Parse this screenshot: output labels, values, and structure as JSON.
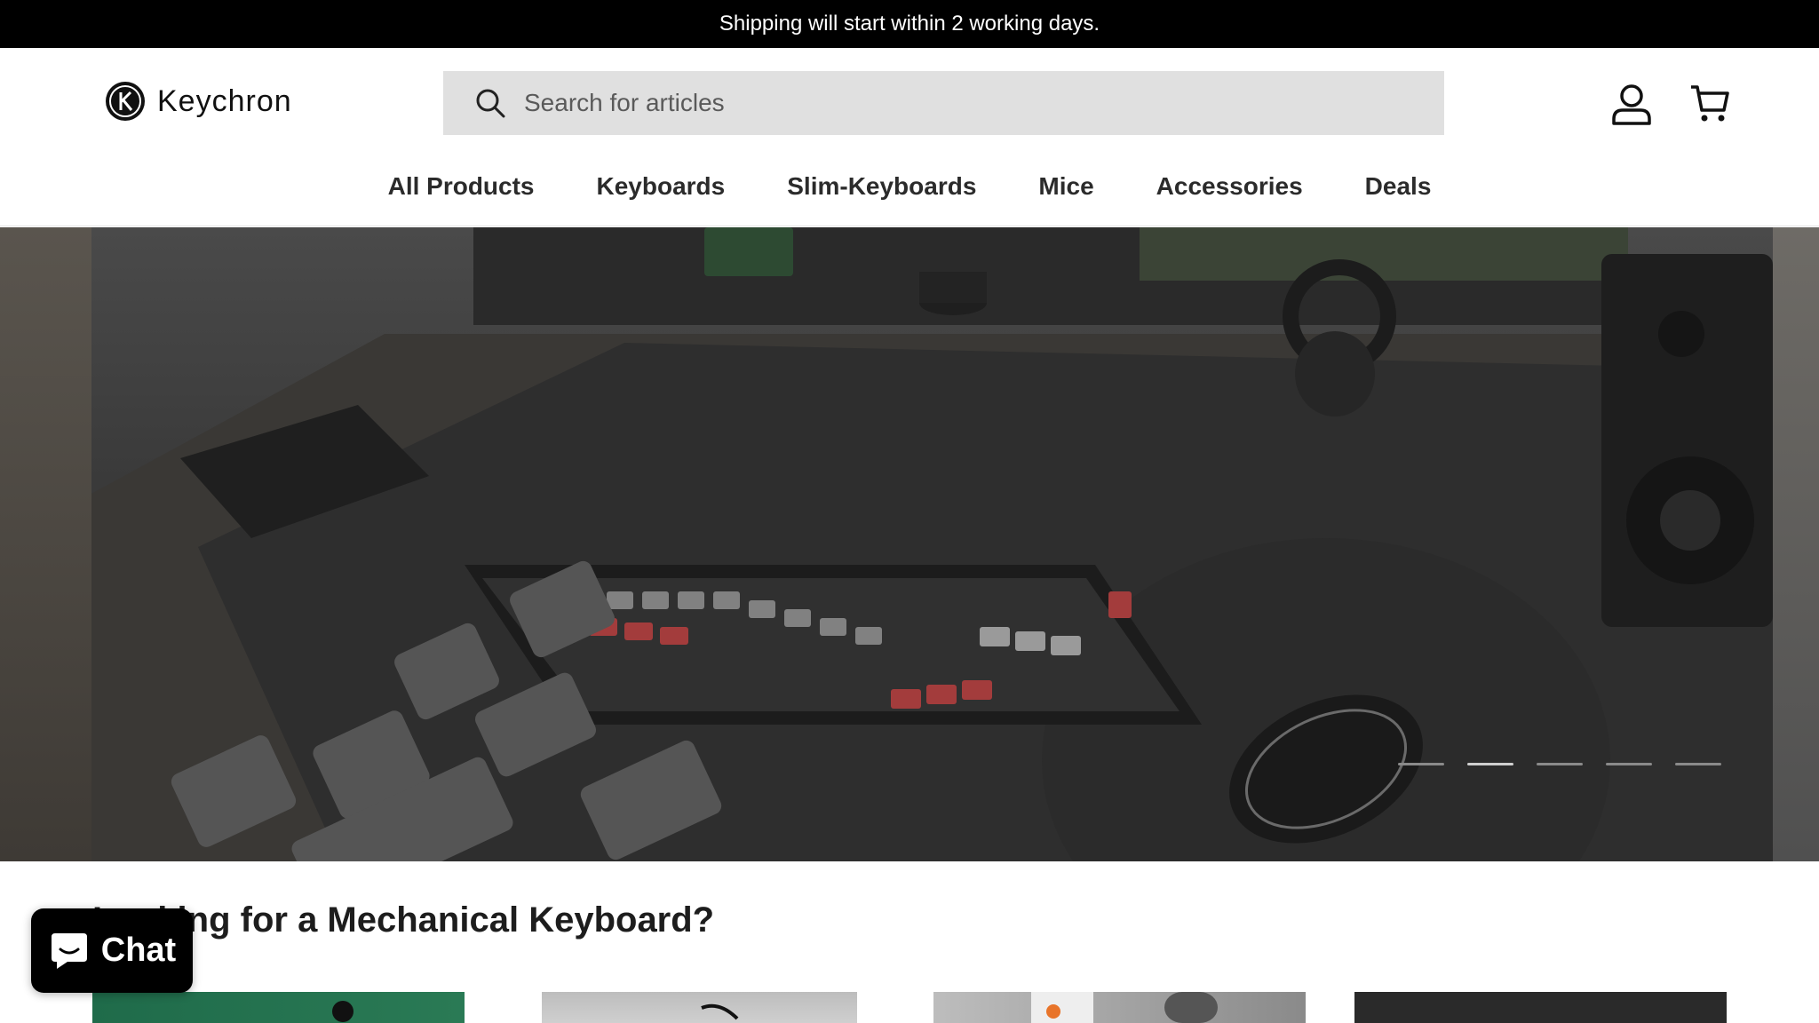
{
  "announcement": {
    "text": "Shipping will start within 2 working days."
  },
  "header": {
    "brand": "Keychron",
    "search_placeholder": "Search for articles"
  },
  "nav": {
    "items": [
      {
        "label": "All Products"
      },
      {
        "label": "Keyboards"
      },
      {
        "label": "Slim-Keyboards"
      },
      {
        "label": "Mice"
      },
      {
        "label": "Accessories"
      },
      {
        "label": "Deals"
      }
    ]
  },
  "hero": {
    "slide_count": 5,
    "active_slide": 2
  },
  "section": {
    "title": "Looking for a Mechanical Keyboard?"
  },
  "chat": {
    "label": "Chat"
  },
  "colors": {
    "announcement_bg": "#000000",
    "search_bg": "#e0e0e0",
    "chat_bg": "#000000"
  }
}
